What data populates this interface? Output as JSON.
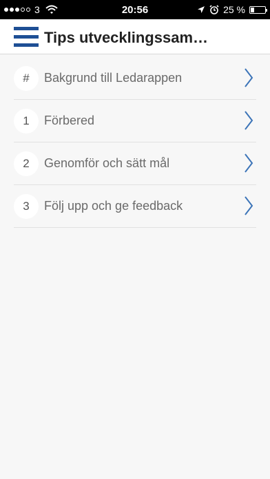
{
  "status_bar": {
    "signal_filled": 3,
    "signal_total": 5,
    "carrier": "3",
    "time": "20:56",
    "battery": "25 %",
    "battery_level": 0.25
  },
  "header": {
    "title": "Tips utvecklingssam…",
    "menu_icon": "hamburger-menu-icon",
    "accent_color": "#1e4f95"
  },
  "items": [
    {
      "badge": "#",
      "label": "Bakgrund till Ledarappen"
    },
    {
      "badge": "1",
      "label": "Förbered"
    },
    {
      "badge": "2",
      "label": "Genomför och sätt mål"
    },
    {
      "badge": "3",
      "label": "Följ upp och ge feedback"
    }
  ],
  "icons": {
    "row_chevron": "chevron-right-icon"
  }
}
